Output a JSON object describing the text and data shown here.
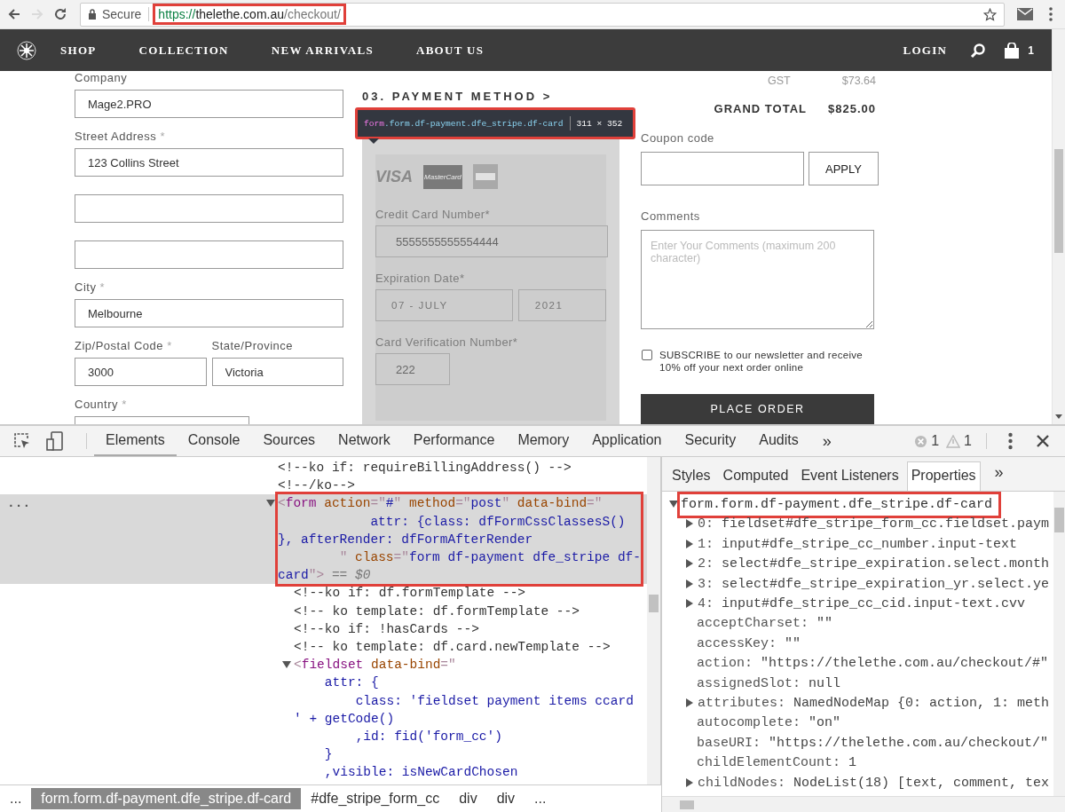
{
  "browser": {
    "nav_buttons": [
      {
        "kind": "back",
        "disabled": false
      },
      {
        "kind": "forward",
        "disabled": true
      },
      {
        "kind": "reload",
        "disabled": false
      }
    ],
    "security_label": "Secure",
    "url": {
      "scheme": "https://",
      "host": "thelethe.com.au",
      "path": "/checkout/",
      "annotated": true
    }
  },
  "site_nav": {
    "items": [
      "SHOP",
      "COLLECTION",
      "NEW ARRIVALS",
      "ABOUT US"
    ],
    "login": "LOGIN",
    "cart_count": "1"
  },
  "address_form": {
    "rows": [
      [
        {
          "kind": "input",
          "label": "Company",
          "value": "Mage2.PRO"
        }
      ],
      [
        {
          "kind": "input",
          "label": "Street Address",
          "required_mark": "*",
          "value": "123 Collins Street"
        }
      ],
      [
        {
          "kind": "input"
        }
      ],
      [
        {
          "kind": "input"
        }
      ],
      [
        {
          "kind": "input",
          "label": "City",
          "required_mark": "*",
          "value": "Melbourne"
        }
      ],
      [
        {
          "kind": "input",
          "label": "Zip/Postal Code",
          "required_mark": "*",
          "value": "3000"
        },
        {
          "kind": "input",
          "label": "State/Province",
          "value": "Victoria"
        }
      ],
      [
        {
          "kind": "select",
          "label": "Country",
          "required_mark": "*"
        }
      ]
    ]
  },
  "payment": {
    "heading": "03. PAYMENT METHOD >",
    "inspect_tooltip": {
      "tag": "form",
      "classes": ".form.df-payment.dfe_stripe.df-card",
      "size": "311 × 352",
      "annotated": true
    },
    "highlighted": true,
    "card_brands": [
      {
        "kind": "visa",
        "text": "VISA"
      },
      {
        "kind": "mastercard",
        "text": "MasterCard"
      },
      {
        "kind": "amex"
      }
    ],
    "fields": [
      {
        "kind": "text",
        "label": "Credit Card Number*",
        "value": "5555555555554444"
      },
      {
        "kind": "date",
        "label": "Expiration Date*",
        "month": "07 - JULY",
        "year": "2021"
      },
      {
        "kind": "cvv",
        "label": "Card Verification Number*",
        "value": "222"
      }
    ]
  },
  "summary": {
    "totals": [
      {
        "kind": "tax",
        "label": "GST",
        "value": "$73.64"
      },
      {
        "kind": "grand",
        "label": "GRAND TOTAL",
        "value": "$825.00"
      }
    ],
    "coupon": {
      "label": "Coupon code",
      "button": "APPLY"
    },
    "comments": {
      "label": "Comments",
      "placeholder": "Enter Your Comments (maximum 200 character)"
    },
    "newsletter": {
      "checked": false,
      "text": "SUBSCRIBE to our newsletter and receive 10% off your next order online"
    },
    "place_order": "PLACE ORDER"
  },
  "devtools": {
    "tabs": [
      {
        "label": "Elements",
        "selected": true
      },
      {
        "label": "Console",
        "selected": false
      },
      {
        "label": "Sources",
        "selected": false
      },
      {
        "label": "Network",
        "selected": false
      },
      {
        "label": "Performance",
        "selected": false
      },
      {
        "label": "Memory",
        "selected": false
      },
      {
        "label": "Application",
        "selected": false
      },
      {
        "label": "Security",
        "selected": false
      },
      {
        "label": "Audits",
        "selected": false
      }
    ],
    "more": "»",
    "errors": "1",
    "warnings": "1",
    "dom_tree": [
      {
        "kind": "comment",
        "selected": false,
        "tokens": [
          {
            "kind": "comment",
            "text": "<!--ko if: requireBillingAddress() -->"
          }
        ]
      },
      {
        "kind": "comment",
        "selected": false,
        "tokens": [
          {
            "kind": "comment",
            "text": "<!--/ko-->"
          }
        ]
      },
      {
        "kind": "element",
        "selected": true,
        "expanded": true,
        "annotated": true,
        "gutter": "...",
        "tokens": [
          {
            "kind": "punct",
            "text": "<"
          },
          {
            "kind": "tag",
            "text": "form"
          },
          {
            "kind": "attr",
            "text": " action"
          },
          {
            "kind": "punct",
            "text": "=\""
          },
          {
            "kind": "value",
            "text": "#"
          },
          {
            "kind": "punct",
            "text": "\""
          },
          {
            "kind": "attr",
            "text": " method"
          },
          {
            "kind": "punct",
            "text": "=\""
          },
          {
            "kind": "value",
            "text": "post"
          },
          {
            "kind": "punct",
            "text": "\""
          },
          {
            "kind": "attr",
            "text": " data-bind"
          },
          {
            "kind": "punct",
            "text": "=\""
          },
          {
            "kind": "value",
            "text": "\n            attr: {class: dfFormCssClassesS() }, afterRender: dfFormAfterRender\n        "
          },
          {
            "kind": "punct",
            "text": "\""
          },
          {
            "kind": "attr",
            "text": " class"
          },
          {
            "kind": "punct",
            "text": "=\""
          },
          {
            "kind": "value",
            "text": "form df-payment dfe_stripe df-card"
          },
          {
            "kind": "punct",
            "text": "\">"
          },
          {
            "kind": "marker",
            "text": " == $0"
          }
        ],
        "children": [
          {
            "kind": "comment",
            "selected": false,
            "tokens": [
              {
                "kind": "comment",
                "text": "<!--ko if: df.formTemplate -->"
              }
            ]
          },
          {
            "kind": "comment",
            "selected": false,
            "tokens": [
              {
                "kind": "comment",
                "text": "<!-- ko template: df.formTemplate -->"
              }
            ]
          },
          {
            "kind": "comment",
            "selected": false,
            "tokens": [
              {
                "kind": "comment",
                "text": "<!--ko if: !hasCards -->"
              }
            ]
          },
          {
            "kind": "comment",
            "selected": false,
            "tokens": [
              {
                "kind": "comment",
                "text": "<!-- ko template: df.card.newTemplate -->"
              }
            ]
          },
          {
            "kind": "element",
            "selected": false,
            "expanded": true,
            "annotated": false,
            "tokens": [
              {
                "kind": "punct",
                "text": "<"
              },
              {
                "kind": "tag",
                "text": "fieldset"
              },
              {
                "kind": "attr",
                "text": " data-bind"
              },
              {
                "kind": "punct",
                "text": "=\""
              },
              {
                "kind": "value",
                "text": "\n    attr: {\n        class: 'fieldset payment items ccard ' + getCode()\n        ,id: fid('form_cc')\n    }\n    ,visible: isNewCardChosen"
              }
            ]
          }
        ]
      }
    ],
    "breadcrumbs": [
      {
        "label": "...",
        "selected": false
      },
      {
        "label": "form.form.df-payment.dfe_stripe.df-card",
        "selected": true
      },
      {
        "label": "#dfe_stripe_form_cc",
        "selected": false
      },
      {
        "label": "div",
        "selected": false
      },
      {
        "label": "div",
        "selected": false
      },
      {
        "label": "...",
        "selected": false
      }
    ],
    "sidebar": {
      "tabs": [
        {
          "label": "Styles",
          "selected": false
        },
        {
          "label": "Computed",
          "selected": false
        },
        {
          "label": "Event Listeners",
          "selected": false
        },
        {
          "label": "Properties",
          "selected": true
        }
      ],
      "more": "»",
      "properties": {
        "header": {
          "text": "form.form.df-payment.dfe_stripe.df-card",
          "expanded": true,
          "annotated": true
        },
        "items": [
          {
            "kind": "expandable",
            "key": "0:",
            "value": "fieldset#dfe_stripe_form_cc.fieldset.paym"
          },
          {
            "kind": "expandable",
            "key": "1:",
            "value": "input#dfe_stripe_cc_number.input-text"
          },
          {
            "kind": "expandable",
            "key": "2:",
            "value": "select#dfe_stripe_expiration.select.month"
          },
          {
            "kind": "expandable",
            "key": "3:",
            "value": "select#dfe_stripe_expiration_yr.select.ye"
          },
          {
            "kind": "expandable",
            "key": "4:",
            "value": "input#dfe_stripe_cc_cid.input-text.cvv"
          },
          {
            "kind": "plain",
            "key": "acceptCharset:",
            "value": "\"\""
          },
          {
            "kind": "plain",
            "key": "accessKey:",
            "value": "\"\""
          },
          {
            "kind": "plain",
            "key": "action:",
            "value": "\"https://thelethe.com.au/checkout/#\""
          },
          {
            "kind": "plain",
            "key": "assignedSlot:",
            "value": "null"
          },
          {
            "kind": "expandable",
            "key": "attributes:",
            "value": "NamedNodeMap {0: action, 1: meth"
          },
          {
            "kind": "plain",
            "key": "autocomplete:",
            "value": "\"on\""
          },
          {
            "kind": "plain",
            "key": "baseURI:",
            "value": "\"https://thelethe.com.au/checkout/\""
          },
          {
            "kind": "plain",
            "key": "childElementCount:",
            "value": "1"
          },
          {
            "kind": "expandable",
            "key": "childNodes:",
            "value": "NodeList(18) [text, comment, tex"
          }
        ]
      }
    }
  }
}
